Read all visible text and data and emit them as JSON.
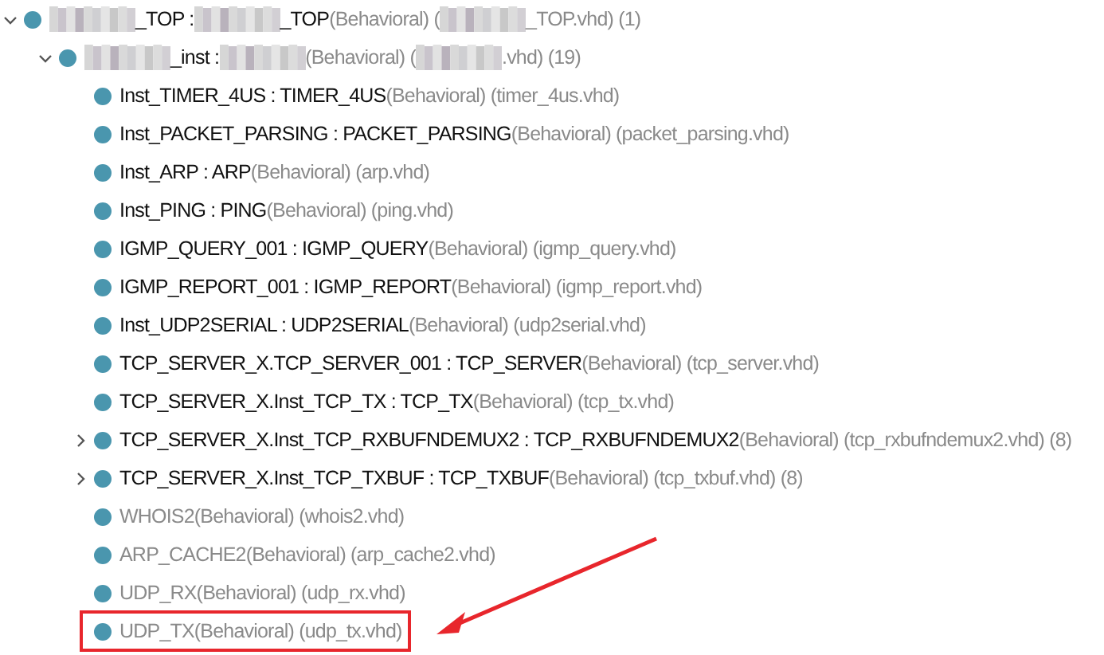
{
  "tree": [
    {
      "expanded": true,
      "parts": [
        {
          "kind": "redacted"
        },
        {
          "kind": "name",
          "text": "_TOP : "
        },
        {
          "kind": "redacted"
        },
        {
          "kind": "name",
          "text": "_TOP"
        },
        {
          "kind": "detail",
          "text": "(Behavioral) ("
        },
        {
          "kind": "redacted"
        },
        {
          "kind": "detail",
          "text": "_TOP.vhd) (1)"
        }
      ],
      "children": [
        {
          "expanded": true,
          "parts": [
            {
              "kind": "redacted"
            },
            {
              "kind": "name",
              "text": "_inst : "
            },
            {
              "kind": "redacted"
            },
            {
              "kind": "detail",
              "text": "(Behavioral) ("
            },
            {
              "kind": "redacted"
            },
            {
              "kind": "detail",
              "text": ".vhd) (19)"
            }
          ],
          "children": [
            {
              "parts": [
                {
                  "kind": "name",
                  "text": "Inst_TIMER_4US : TIMER_4US"
                },
                {
                  "kind": "detail",
                  "text": "(Behavioral) (timer_4us.vhd)"
                }
              ]
            },
            {
              "parts": [
                {
                  "kind": "name",
                  "text": "Inst_PACKET_PARSING : PACKET_PARSING"
                },
                {
                  "kind": "detail",
                  "text": "(Behavioral) (packet_parsing.vhd)"
                }
              ]
            },
            {
              "parts": [
                {
                  "kind": "name",
                  "text": "Inst_ARP : ARP"
                },
                {
                  "kind": "detail",
                  "text": "(Behavioral) (arp.vhd)"
                }
              ]
            },
            {
              "parts": [
                {
                  "kind": "name",
                  "text": "Inst_PING : PING"
                },
                {
                  "kind": "detail",
                  "text": "(Behavioral) (ping.vhd)"
                }
              ]
            },
            {
              "parts": [
                {
                  "kind": "name",
                  "text": "IGMP_QUERY_001 : IGMP_QUERY"
                },
                {
                  "kind": "detail",
                  "text": "(Behavioral) (igmp_query.vhd)"
                }
              ]
            },
            {
              "parts": [
                {
                  "kind": "name",
                  "text": "IGMP_REPORT_001 : IGMP_REPORT"
                },
                {
                  "kind": "detail",
                  "text": "(Behavioral) (igmp_report.vhd)"
                }
              ]
            },
            {
              "parts": [
                {
                  "kind": "name",
                  "text": "Inst_UDP2SERIAL : UDP2SERIAL"
                },
                {
                  "kind": "detail",
                  "text": "(Behavioral) (udp2serial.vhd)"
                }
              ]
            },
            {
              "parts": [
                {
                  "kind": "name",
                  "text": "TCP_SERVER_X.TCP_SERVER_001 : TCP_SERVER"
                },
                {
                  "kind": "detail",
                  "text": "(Behavioral) (tcp_server.vhd)"
                }
              ]
            },
            {
              "parts": [
                {
                  "kind": "name",
                  "text": "TCP_SERVER_X.Inst_TCP_TX : TCP_TX"
                },
                {
                  "kind": "detail",
                  "text": "(Behavioral) (tcp_tx.vhd)"
                }
              ]
            },
            {
              "expanded": false,
              "parts": [
                {
                  "kind": "name",
                  "text": "TCP_SERVER_X.Inst_TCP_RXBUFNDEMUX2 : TCP_RXBUFNDEMUX2"
                },
                {
                  "kind": "detail",
                  "text": "(Behavioral) (tcp_rxbufndemux2.vhd) (8)"
                }
              ]
            },
            {
              "expanded": false,
              "parts": [
                {
                  "kind": "name",
                  "text": "TCP_SERVER_X.Inst_TCP_TXBUF : TCP_TXBUF"
                },
                {
                  "kind": "detail",
                  "text": "(Behavioral) (tcp_txbuf.vhd) (8)"
                }
              ]
            },
            {
              "parts": [
                {
                  "kind": "detail",
                  "text": "WHOIS2(Behavioral) (whois2.vhd)"
                }
              ]
            },
            {
              "parts": [
                {
                  "kind": "detail",
                  "text": "ARP_CACHE2(Behavioral) (arp_cache2.vhd)"
                }
              ]
            },
            {
              "parts": [
                {
                  "kind": "detail",
                  "text": "UDP_RX(Behavioral) (udp_rx.vhd)"
                }
              ]
            },
            {
              "highlighted": true,
              "parts": [
                {
                  "kind": "detail",
                  "text": "UDP_TX(Behavioral) (udp_tx.vhd)"
                }
              ]
            }
          ]
        }
      ]
    }
  ]
}
